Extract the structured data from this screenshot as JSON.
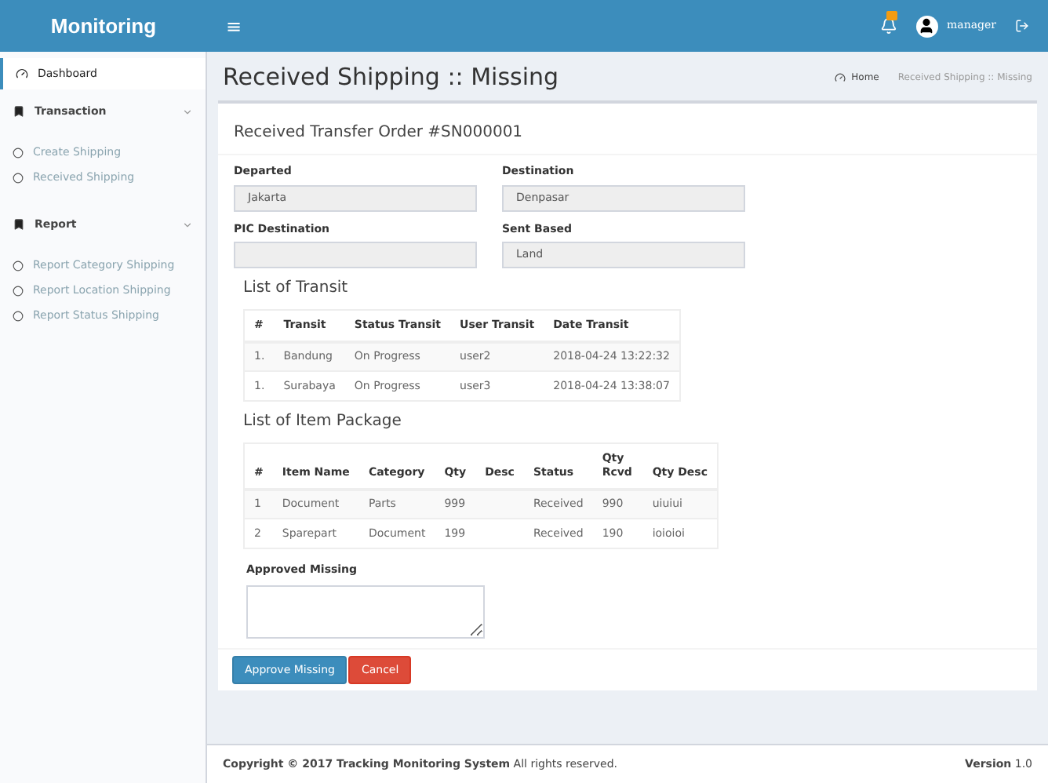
{
  "header": {
    "brand": "Monitoring",
    "menu_toggle": "≡",
    "user": "manager"
  },
  "sidebar": {
    "items": [
      {
        "label": "Dashboard",
        "kind": "link",
        "selected": true
      },
      {
        "label": "Transaction",
        "kind": "group",
        "expanded": true,
        "children": [
          {
            "label": "Create Shipping",
            "selected": false
          },
          {
            "label": "Received Shipping",
            "selected": false
          }
        ]
      },
      {
        "label": "Report",
        "kind": "group",
        "expanded": true,
        "children": [
          {
            "label": "Report Category Shipping",
            "selected": false
          },
          {
            "label": "Report Location Shipping",
            "selected": false
          },
          {
            "label": "Report Status Shipping",
            "selected": false
          }
        ]
      }
    ]
  },
  "page": {
    "title": "Received Shipping :: Missing",
    "breadcrumb": [
      "Home",
      "Received Shipping :: Missing"
    ]
  },
  "card": {
    "title": "Received Transfer Order #SN000001",
    "fields": [
      {
        "label": "Departed",
        "value": "Jakarta"
      },
      {
        "label": "Destination",
        "value": "Denpasar"
      },
      {
        "label": "PIC Destination"
      },
      {
        "label": "Sent Based",
        "value": "Land"
      }
    ],
    "transit": {
      "title": "List of Transit",
      "columns": [
        "#",
        "Transit",
        "Status Transit",
        "User Transit",
        "Date Transit"
      ],
      "rows": [
        [
          "1.",
          "Bandung",
          "On Progress",
          "user2",
          "2018-04-24 13:22:32"
        ],
        [
          "1.",
          "Surabaya",
          "On Progress",
          "user3",
          "2018-04-24 13:38:07"
        ]
      ]
    },
    "items": {
      "title": "List of Item Package",
      "columns": [
        "#",
        "Item Name",
        "Category",
        "Qty",
        "Desc",
        "Status",
        "Qty Rcvd",
        "Qty Desc"
      ],
      "rows": [
        [
          "1",
          "Document",
          "Parts",
          "999",
          "",
          "Received",
          "990",
          "uiuiui"
        ],
        [
          "2",
          "Sparepart",
          "Document",
          "199",
          "",
          "Received",
          "190",
          "ioioioi"
        ]
      ]
    },
    "approved_missing": {
      "label": "Approved Missing"
    },
    "buttons": [
      {
        "label": "Approve Missing",
        "kind": "primary"
      },
      {
        "label": "Cancel",
        "kind": "danger"
      }
    ]
  },
  "footer": {
    "copyright": "**Copyright © 2017 Tracking Monitoring System** All rights reserved.",
    "version": "**Version** 1.0"
  }
}
